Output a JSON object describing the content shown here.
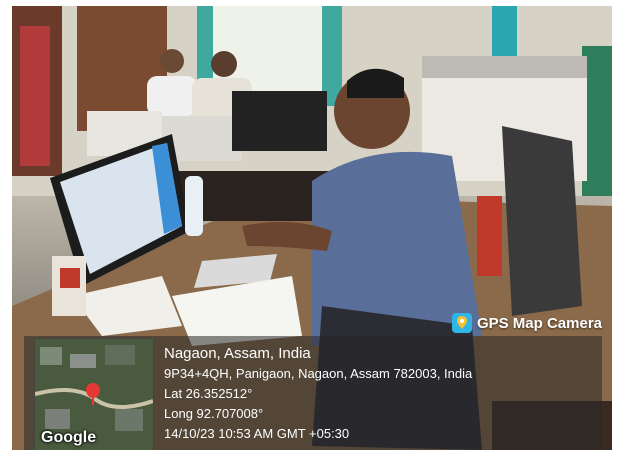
{
  "badge": {
    "label": "GPS Map Camera",
    "icon": "map-pin-icon"
  },
  "map": {
    "attribution": "Google",
    "pin_color": "#e53935"
  },
  "location": {
    "place": "Nagaon, Assam, India",
    "address": "9P34+4QH, Panigaon, Nagaon, Assam 782003, India",
    "lat": "Lat 26.352512°",
    "long": "Long 92.707008°",
    "datetime": "14/10/23 10:53 AM GMT +05:30"
  }
}
